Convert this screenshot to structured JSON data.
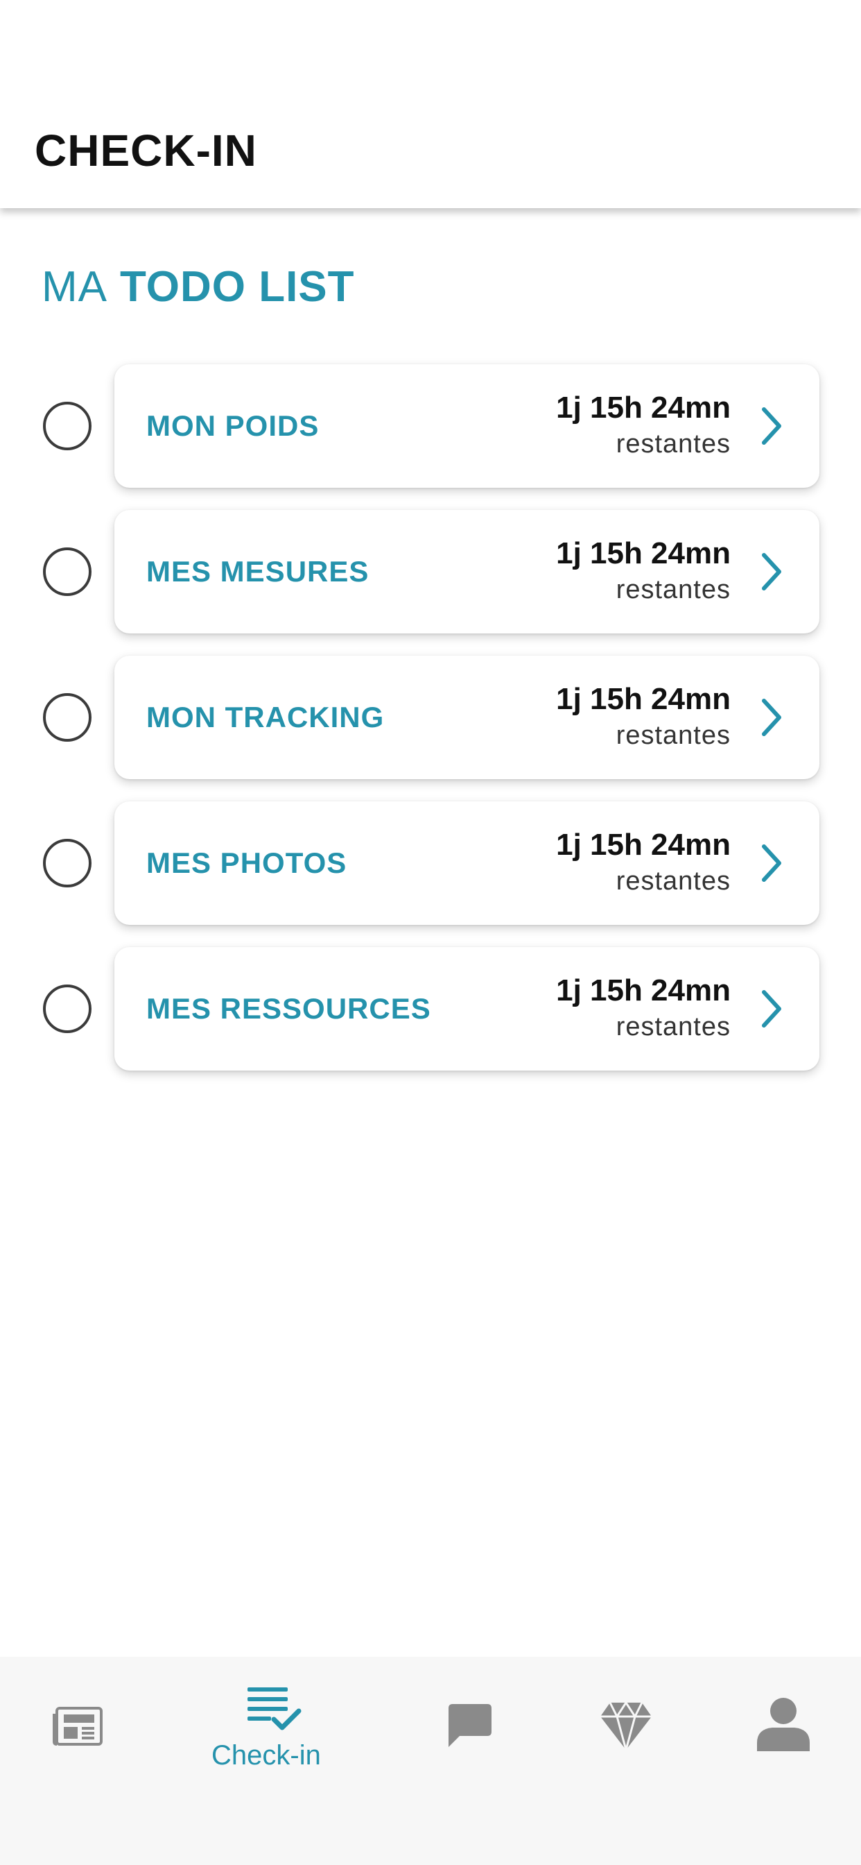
{
  "header": {
    "title": "CHECK-IN"
  },
  "section": {
    "title_light": "MA",
    "title_bold": "TODO LIST"
  },
  "todo_items": [
    {
      "label": "MON POIDS",
      "time": "1j 15h 24mn",
      "suffix": "restantes",
      "checked": false
    },
    {
      "label": "MES MESURES",
      "time": "1j 15h 24mn",
      "suffix": "restantes",
      "checked": false
    },
    {
      "label": "MON TRACKING",
      "time": "1j 15h 24mn",
      "suffix": "restantes",
      "checked": false
    },
    {
      "label": "MES PHOTOS",
      "time": "1j 15h 24mn",
      "suffix": "restantes",
      "checked": false
    },
    {
      "label": "MES RESSOURCES",
      "time": "1j 15h 24mn",
      "suffix": "restantes",
      "checked": false
    }
  ],
  "bottom_nav": {
    "items": [
      {
        "icon": "newspaper-icon",
        "label": ""
      },
      {
        "icon": "checklist-icon",
        "label": "Check-in",
        "active": true
      },
      {
        "icon": "chat-bubble-icon",
        "label": ""
      },
      {
        "icon": "diamond-icon",
        "label": ""
      },
      {
        "icon": "user-icon",
        "label": ""
      }
    ]
  },
  "colors": {
    "accent": "#2592ac",
    "text_dark": "#111111",
    "icon_inactive": "#8a8a8a",
    "nav_background": "#f7f7f7"
  }
}
